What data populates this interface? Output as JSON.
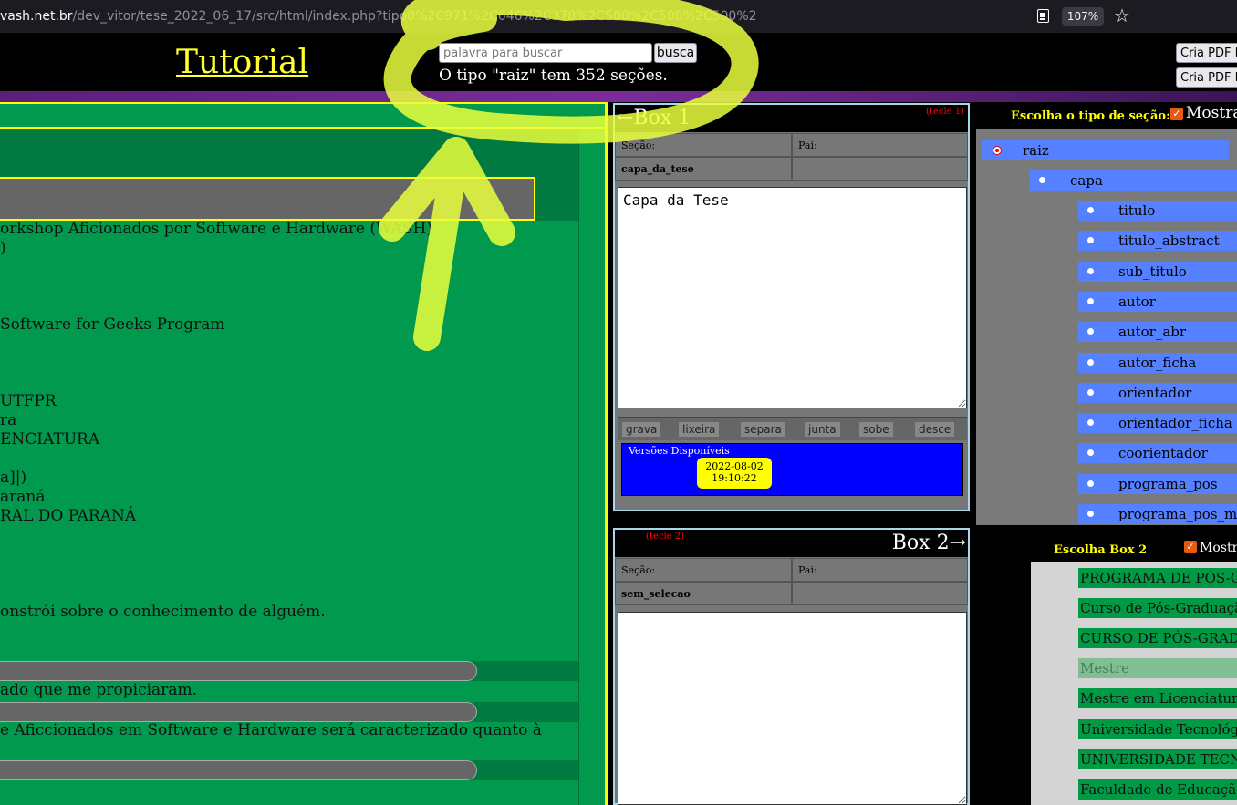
{
  "browser": {
    "url_prefix": "vash.net.br",
    "url_rest": "/dev_vitor/tese_2022_06_17/src/html/index.php?tipo",
    "url_tail": "0%2C971%2C646%2C378%2C500%2C500%2C500%2",
    "zoom": "107%",
    "star_glyph": "☆"
  },
  "header": {
    "logo": "Tutorial",
    "search_placeholder": "palavra para buscar",
    "search_button": "busca",
    "section_count": "O tipo \"raiz\" tem 352 seções.",
    "pdf_button_1": "Cria PDF D",
    "pdf_button_2": "Cria PDF F"
  },
  "left_panel": {
    "lines": [
      "orkshop Aficionados por Software e Hardware (WASH)",
      ")",
      "Software for Geeks Program",
      "UTFPR",
      "ra",
      "ENCIATURA",
      "a]|)",
      "araná",
      "RAL DO PARANÁ",
      "onstrói sobre o conhecimento de alguém.",
      "ado que me propiciaram.",
      "e Aficcionados em Software e Hardware será caracterizado quanto à"
    ]
  },
  "box1": {
    "title": "←Box 1",
    "hint": "(tecle 1)",
    "secao_label": "Seção:",
    "pai_label": "Pai:",
    "secao_value": "capa_da_tese",
    "pai_value": "",
    "content": "Capa da Tese",
    "buttons": [
      "grava",
      "lixeira",
      "separa",
      "junta",
      "sobe",
      "desce"
    ],
    "versions_label": "Versões Disponíveis",
    "version_date": "2022-08-02",
    "version_time": "19:10:22"
  },
  "box2": {
    "title": "Box 2→",
    "hint": "(tecle 2)",
    "secao_label": "Seção:",
    "pai_label": "Pai:",
    "secao_value": "sem_selecao",
    "pai_value": "",
    "content": ""
  },
  "right_panel1": {
    "label": "Escolha o tipo de seção:",
    "show_label": "Mostra",
    "root": "raiz",
    "level1": "capa",
    "children": [
      "titulo",
      "titulo_abstract",
      "sub_titulo",
      "autor",
      "autor_abr",
      "autor_ficha",
      "orientador",
      "orientador_ficha",
      "coorientador",
      "programa_pos",
      "programa_pos_ma"
    ]
  },
  "right_panel2": {
    "label": "Escolha Box 2",
    "show_label": "Mostr",
    "items": [
      "PROGRAMA DE PÓS-GR",
      "Curso de Pós-Graduaçã",
      "CURSO DE PÓS-GRADU",
      "Mestre",
      "Mestre em Licenciatura",
      "Universidade Tecnológic",
      "UNIVERSIDADE TECNO",
      "Faculdade de Educação"
    ]
  },
  "colors": {
    "accent_yellow": "#ffff33",
    "panel_green": "#00994d",
    "tree_blue": "#5580ff",
    "versions_blue": "#0000ff"
  }
}
